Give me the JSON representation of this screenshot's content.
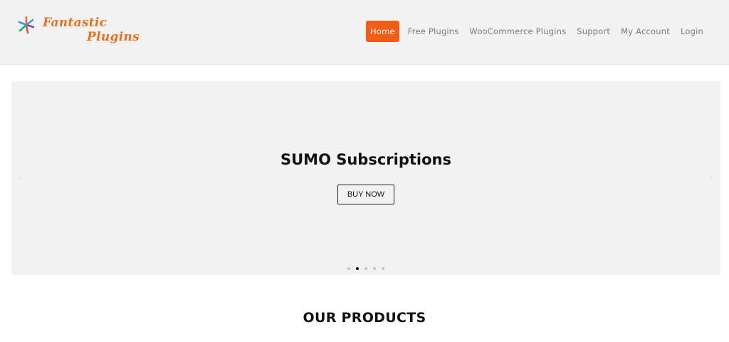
{
  "brand": {
    "logo_icon": "pinwheel-logo-icon",
    "word1": "Fantastic",
    "word2": "Plugins",
    "color": "#e8711f"
  },
  "nav": {
    "active_color": "#f25d18",
    "items": [
      {
        "label": "Home",
        "active": true
      },
      {
        "label": "Free Plugins",
        "active": false
      },
      {
        "label": "WooCommerce Plugins",
        "active": false
      },
      {
        "label": "Support",
        "active": false
      },
      {
        "label": "My Account",
        "active": false
      },
      {
        "label": "Login",
        "active": false
      }
    ]
  },
  "hero": {
    "title": "SUMO Subscriptions",
    "button_label": "BUY NOW",
    "prev_icon": "chevron-left-icon",
    "next_icon": "chevron-right-icon",
    "slide_count": 5,
    "active_slide": 2
  },
  "products": {
    "heading": "OUR PRODUCTS"
  }
}
